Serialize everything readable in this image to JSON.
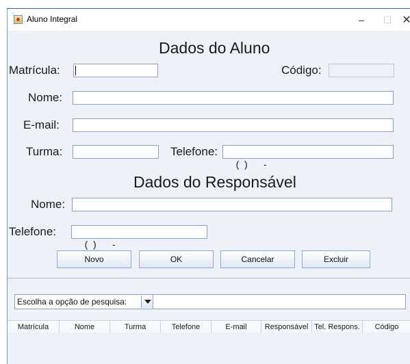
{
  "window": {
    "title": "Aluno Integral",
    "controls": {
      "minimize": "–",
      "maximize": "☐",
      "close": "✕"
    }
  },
  "aluno": {
    "heading": "Dados do Aluno",
    "matricula_label": "Matrícula:",
    "matricula_value": "",
    "codigo_label": "Código:",
    "codigo_value": "",
    "nome_label": "Nome:",
    "nome_value": "",
    "email_label": "E-mail:",
    "email_value": "",
    "turma_label": "Turma:",
    "turma_value": "",
    "telefone_label": "Telefone:",
    "telefone_value": "(  )      -"
  },
  "responsavel": {
    "heading": "Dados do Responsável",
    "nome_label": "Nome:",
    "nome_value": "",
    "telefone_label": "Telefone:",
    "telefone_value": "(  )      -"
  },
  "buttons": {
    "novo": "Novo",
    "ok": "OK",
    "cancelar": "Cancelar",
    "excluir": "Excluir"
  },
  "search": {
    "combo_label": "Escolha a opção de pesquisa:",
    "query": ""
  },
  "table": {
    "columns": [
      "Matrícula",
      "Nome",
      "Turma",
      "Telefone",
      "E-mail",
      "Responsável",
      "Tel. Respons.",
      "Código"
    ],
    "rows": []
  }
}
